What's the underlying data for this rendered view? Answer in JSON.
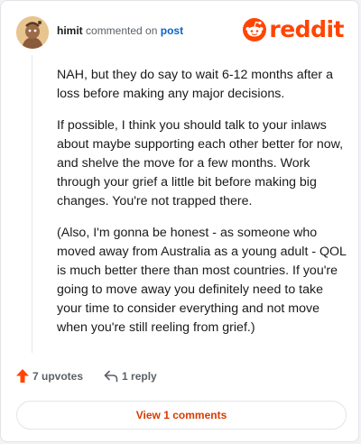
{
  "header": {
    "username": "himit",
    "commented_text": "commented on",
    "post_link": "post"
  },
  "logo": {
    "wordmark": "reddit",
    "icon": "reddit-snoo-icon",
    "color": "#ff4500"
  },
  "comment": {
    "paragraphs": [
      "NAH, but they do say to wait 6-12 months after a loss before making any major decisions.",
      "If possible, I think you should talk to your inlaws about maybe supporting each other better for now, and shelve the move for a few months. Work through your grief a little bit before making big changes. You're not trapped there.",
      "(Also, I'm gonna be honest - as someone who moved away from Australia as a young adult - QOL is much better there than most countries. If you're going to move away you definitely need to take your time to consider everything and not move when you're still reeling from grief.)"
    ]
  },
  "footer": {
    "upvotes": "7 upvotes",
    "upvote_icon": "upvote-arrow-icon",
    "replies": "1 reply",
    "reply_icon": "reply-arrow-icon"
  },
  "view_comments": "View 1 comments",
  "colors": {
    "accent": "#ff4500",
    "link": "#0a63c9",
    "button_text": "#d93a00"
  }
}
